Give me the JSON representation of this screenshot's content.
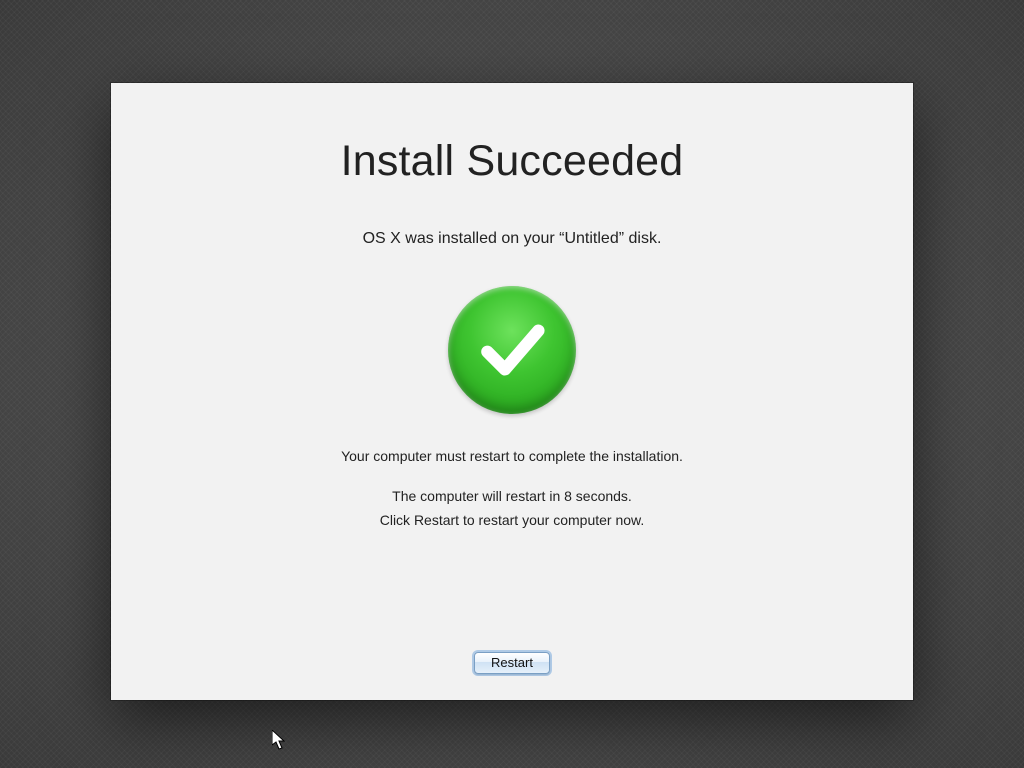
{
  "dialog": {
    "title": "Install Succeeded",
    "subtitle": "OS X was installed on your “Untitled” disk.",
    "message_restart_required": "Your computer must restart to complete the installation.",
    "message_countdown": "The computer will restart in 8 seconds.",
    "message_click_restart": "Click Restart to restart your computer now.",
    "restart_button_label": "Restart"
  }
}
